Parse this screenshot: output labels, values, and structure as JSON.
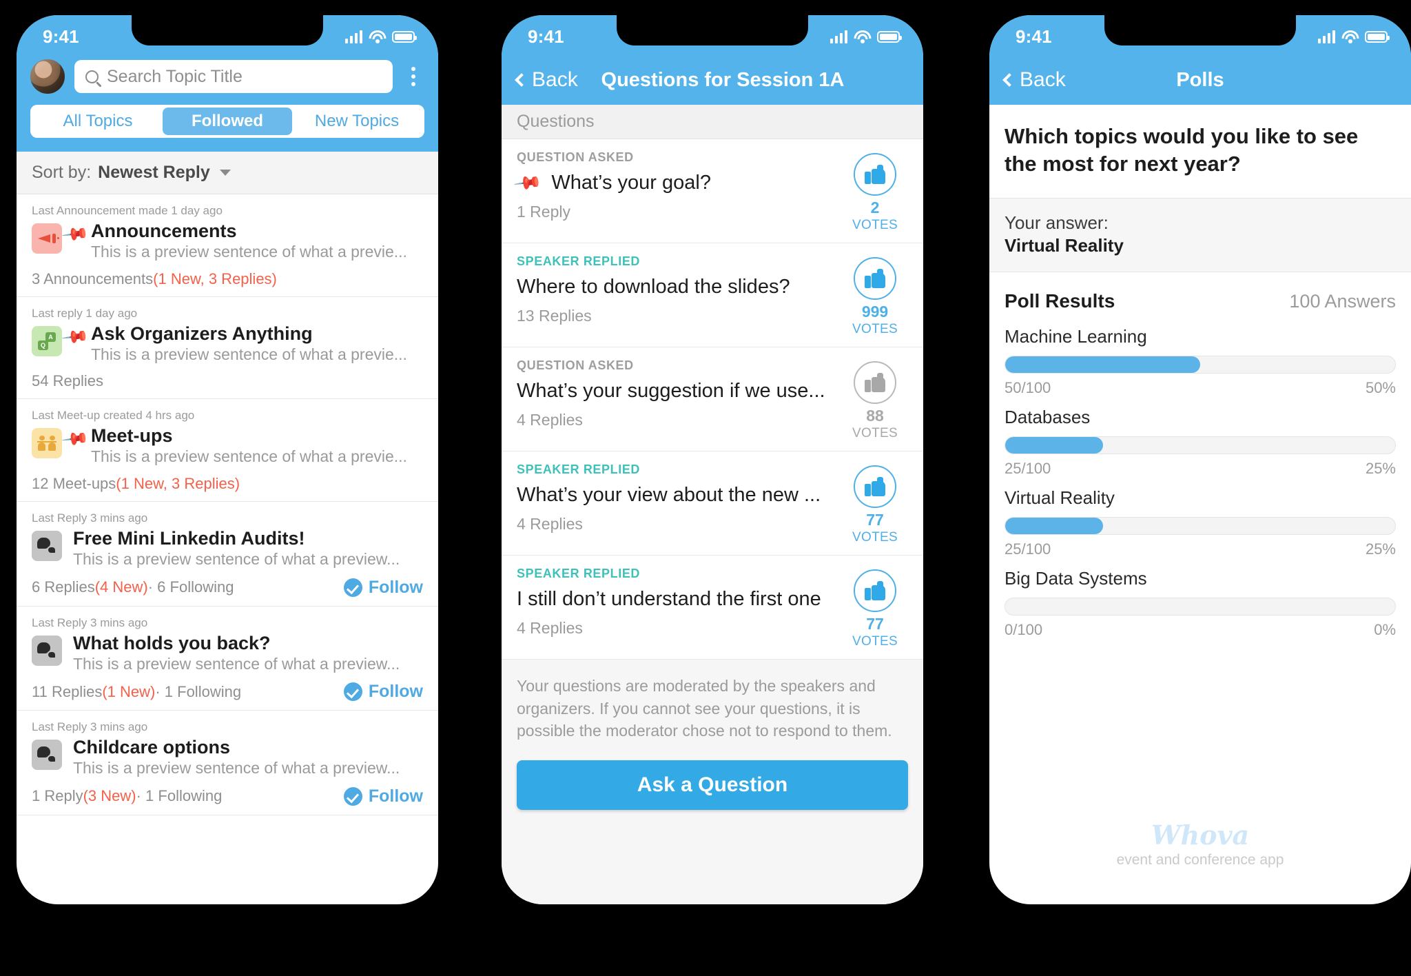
{
  "status_bar": {
    "time": "9:41"
  },
  "phone1": {
    "search": {
      "placeholder": "Search Topic Title",
      "icon": "search-icon"
    },
    "avatar": "user-avatar",
    "menu_icon": "kebab-menu-icon",
    "tabs": [
      {
        "label": "All Topics",
        "active": false
      },
      {
        "label": "Followed",
        "active": true
      },
      {
        "label": "New Topics",
        "active": false
      }
    ],
    "sort": {
      "label": "Sort by:",
      "value": "Newest Reply",
      "icon": "chevron-down-icon"
    },
    "topics": [
      {
        "time": "Last Announcement made 1 day ago",
        "title": "Announcements",
        "preview": "This is a preview sentence of what a previe...",
        "count": "3 Announcements ",
        "new": "(1 New, 3 Replies)",
        "following": "",
        "icon": "megaphone-icon",
        "pinned": true,
        "follow": null
      },
      {
        "time": "Last reply 1 day ago",
        "title": "Ask Organizers Anything",
        "preview": "This is a preview sentence of what a previe...",
        "count": "54 Replies",
        "new": "",
        "following": "",
        "icon": "ask-organizers-icon",
        "pinned": true,
        "follow": null
      },
      {
        "time": "Last Meet-up created 4 hrs ago",
        "title": "Meet-ups",
        "preview": "This is a preview sentence of what a previe...",
        "count": "12 Meet-ups ",
        "new": "(1 New, 3 Replies)",
        "following": "",
        "icon": "meetups-icon",
        "pinned": true,
        "follow": null
      },
      {
        "time": "Last Reply 3 mins ago",
        "title": "Free Mini Linkedin Audits!",
        "preview": "This is a preview sentence of what a preview...",
        "count": "6 Replies  ",
        "new": "(4 New)",
        "following": " · 6 Following",
        "icon": "chat-bubbles-icon",
        "pinned": false,
        "follow": "Follow"
      },
      {
        "time": "Last Reply 3 mins ago",
        "title": "What holds you back?",
        "preview": "This is a preview sentence of what a preview...",
        "count": "11 Replies ",
        "new": "(1 New)",
        "following": "  ·  1 Following",
        "icon": "chat-bubbles-icon",
        "pinned": false,
        "follow": "Follow"
      },
      {
        "time": "Last Reply 3 mins ago",
        "title": "Childcare options",
        "preview": "This is a preview sentence of what a preview...",
        "count": "1 Reply ",
        "new": "(3 New)",
        "following": "  · 1 Following",
        "icon": "chat-bubbles-icon",
        "pinned": false,
        "follow": "Follow"
      }
    ]
  },
  "phone2": {
    "back_label": "Back",
    "title": "Questions for Session 1A",
    "section_label": "Questions",
    "questions": [
      {
        "tag": "QUESTION ASKED",
        "tag_type": "asked",
        "title": "What’s your goal?",
        "replies": "1 Reply",
        "votes": "2",
        "votes_label": "VOTES",
        "voted": true,
        "pinned": true
      },
      {
        "tag": "SPEAKER REPLIED",
        "tag_type": "replied",
        "title": "Where to download the slides?",
        "replies": "13 Replies",
        "votes": "999",
        "votes_label": "VOTES",
        "voted": true,
        "pinned": false
      },
      {
        "tag": "QUESTION ASKED",
        "tag_type": "asked",
        "title": "What’s your suggestion if we use...",
        "replies": "4 Replies",
        "votes": "88",
        "votes_label": "VOTES",
        "voted": false,
        "pinned": false
      },
      {
        "tag": "SPEAKER REPLIED",
        "tag_type": "replied",
        "title": "What’s your view about the new ...",
        "replies": "4 Replies",
        "votes": "77",
        "votes_label": "VOTES",
        "voted": true,
        "pinned": false
      },
      {
        "tag": "SPEAKER REPLIED",
        "tag_type": "replied",
        "title": "I still don’t understand the first one",
        "replies": "4 Replies",
        "votes": "77",
        "votes_label": "VOTES",
        "voted": true,
        "pinned": false
      }
    ],
    "moderation_note": "Your questions are moderated by the speakers and organizers. If you cannot see your questions, it is possible the moderator chose not to respond to them.",
    "ask_button": "Ask a Question"
  },
  "phone3": {
    "back_label": "Back",
    "title": "Polls",
    "question": "Which topics would you like to see the most for next year?",
    "your_answer_label": "Your answer:",
    "your_answer": "Virtual Reality",
    "results_title": "Poll Results",
    "answers_count": "100 Answers",
    "footer_logo": "Whova",
    "footer_tagline": "event and conference app",
    "chart_data": {
      "type": "bar",
      "title": "Poll Results",
      "subtitle": "Which topics would you like to see the most for next year?",
      "total_answers": 100,
      "categories": [
        "Machine Learning",
        "Databases",
        "Virtual Reality",
        "Big Data Systems"
      ],
      "values": [
        50,
        25,
        25,
        0
      ],
      "percent": [
        50,
        25,
        25,
        0
      ],
      "ratio_labels": [
        "50/100",
        "25/100",
        "25/100",
        "0/100"
      ],
      "percent_labels": [
        "50%",
        "25%",
        "25%",
        "0%"
      ],
      "xlabel": "",
      "ylabel": "",
      "xlim": [
        0,
        100
      ],
      "orientation": "horizontal",
      "grid": false,
      "legend": false,
      "bar_color": "#5cb3e8",
      "track_color": "#f4f4f4"
    }
  },
  "colors": {
    "accent_blue": "#54b3ea",
    "button_blue": "#33aae6",
    "red_badge": "#f4604a",
    "teal_tag": "#3fc0b8"
  }
}
